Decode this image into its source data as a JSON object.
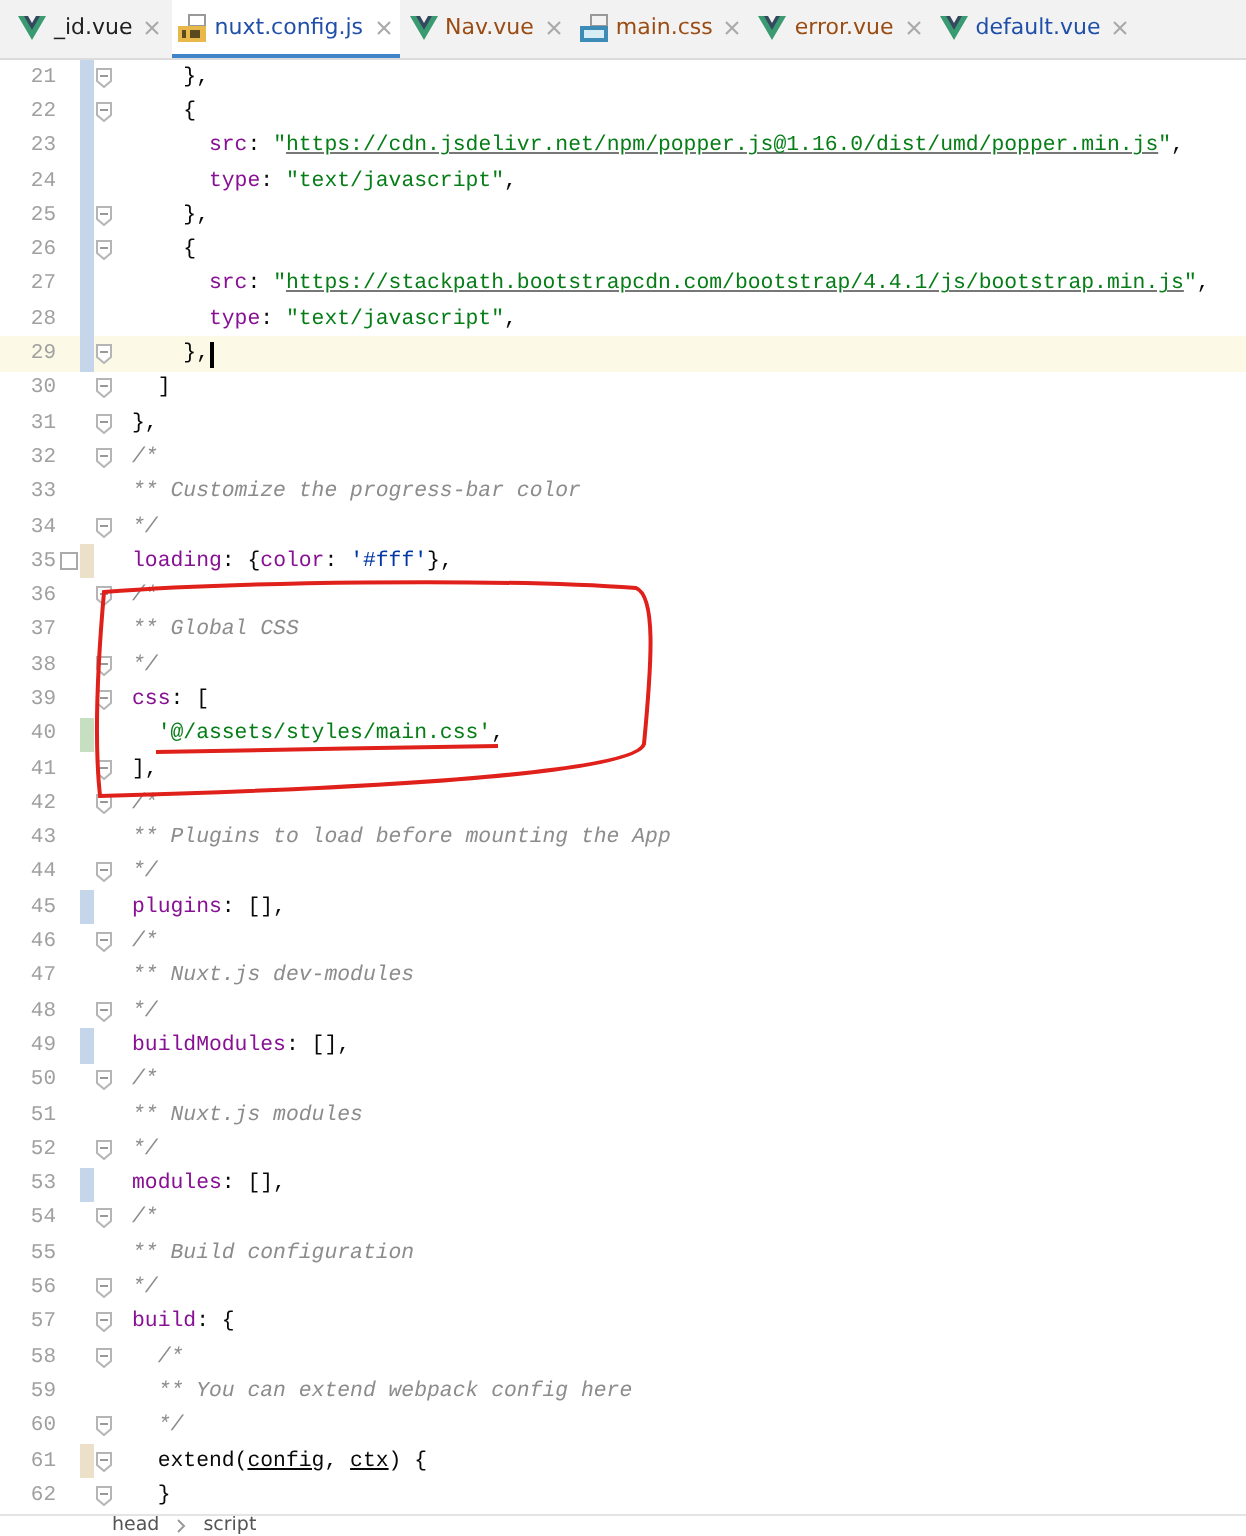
{
  "tabs": [
    {
      "label": "_id.vue",
      "kind": "vue",
      "color": "#202020",
      "selected": false
    },
    {
      "label": "nuxt.config.js",
      "kind": "js",
      "color": "#1f4fa8",
      "selected": true
    },
    {
      "label": "Nav.vue",
      "kind": "vue",
      "color": "#9a4c12",
      "selected": false
    },
    {
      "label": "main.css",
      "kind": "css",
      "color": "#9a4c12",
      "selected": false
    },
    {
      "label": "error.vue",
      "kind": "vue",
      "color": "#9a4c12",
      "selected": false
    },
    {
      "label": "default.vue",
      "kind": "vue",
      "color": "#1f4fa8",
      "selected": false
    }
  ],
  "lines": [
    {
      "number": "21",
      "color": "#c6d6ea",
      "fold": true,
      "bookmark": false,
      "current": false,
      "tokens": [
        {
          "kind": "plain",
          "text": "    },"
        }
      ]
    },
    {
      "number": "22",
      "color": "#c6d6ea",
      "fold": true,
      "bookmark": false,
      "current": false,
      "tokens": [
        {
          "kind": "plain",
          "text": "    {"
        }
      ]
    },
    {
      "number": "23",
      "color": "#c6d6ea",
      "fold": false,
      "bookmark": false,
      "current": false,
      "tokens": [
        {
          "kind": "key",
          "text": "      src"
        },
        {
          "kind": "plain",
          "text": ": "
        },
        {
          "kind": "string",
          "text": "\""
        },
        {
          "kind": "url",
          "text": "https://cdn.jsdelivr.net/npm/popper.js@1.16.0/dist/umd/popper.min.js"
        },
        {
          "kind": "string",
          "text": "\""
        },
        {
          "kind": "plain",
          "text": ","
        }
      ]
    },
    {
      "number": "24",
      "color": "#c6d6ea",
      "fold": false,
      "bookmark": false,
      "current": false,
      "tokens": [
        {
          "kind": "key",
          "text": "      type"
        },
        {
          "kind": "plain",
          "text": ": "
        },
        {
          "kind": "string",
          "text": "\"text/javascript\""
        },
        {
          "kind": "plain",
          "text": ","
        }
      ]
    },
    {
      "number": "25",
      "color": "#c6d6ea",
      "fold": true,
      "bookmark": false,
      "current": false,
      "tokens": [
        {
          "kind": "plain",
          "text": "    },"
        }
      ]
    },
    {
      "number": "26",
      "color": "#c6d6ea",
      "fold": true,
      "bookmark": false,
      "current": false,
      "tokens": [
        {
          "kind": "plain",
          "text": "    {"
        }
      ]
    },
    {
      "number": "27",
      "color": "#c6d6ea",
      "fold": false,
      "bookmark": false,
      "current": false,
      "tokens": [
        {
          "kind": "key",
          "text": "      src"
        },
        {
          "kind": "plain",
          "text": ": "
        },
        {
          "kind": "string",
          "text": "\""
        },
        {
          "kind": "url",
          "text": "https://stackpath.bootstrapcdn.com/bootstrap/4.4.1/js/bootstrap.min.js"
        },
        {
          "kind": "string",
          "text": "\""
        },
        {
          "kind": "plain",
          "text": ","
        }
      ]
    },
    {
      "number": "28",
      "color": "#c6d6ea",
      "fold": false,
      "bookmark": false,
      "current": false,
      "tokens": [
        {
          "kind": "key",
          "text": "      type"
        },
        {
          "kind": "plain",
          "text": ": "
        },
        {
          "kind": "string",
          "text": "\"text/javascript\""
        },
        {
          "kind": "plain",
          "text": ","
        }
      ]
    },
    {
      "number": "29",
      "color": "#c6d6ea",
      "fold": true,
      "bookmark": false,
      "current": true,
      "tokens": [
        {
          "kind": "plain",
          "text": "    },"
        }
      ]
    },
    {
      "number": "30",
      "fold": true,
      "bookmark": false,
      "current": false,
      "tokens": [
        {
          "kind": "plain",
          "text": "  ]"
        }
      ]
    },
    {
      "number": "31",
      "fold": true,
      "bookmark": false,
      "current": false,
      "tokens": [
        {
          "kind": "plain",
          "text": "},"
        }
      ]
    },
    {
      "number": "32",
      "fold": true,
      "bookmark": false,
      "current": false,
      "tokens": [
        {
          "kind": "comment",
          "text": "/*"
        }
      ]
    },
    {
      "number": "33",
      "fold": false,
      "bookmark": false,
      "current": false,
      "tokens": [
        {
          "kind": "comment",
          "text": "** Customize the progress-bar color"
        }
      ]
    },
    {
      "number": "34",
      "fold": true,
      "bookmark": false,
      "current": false,
      "tokens": [
        {
          "kind": "comment",
          "text": "*/"
        }
      ]
    },
    {
      "number": "35",
      "color": "#ece0c8",
      "fold": false,
      "bookmark": true,
      "current": false,
      "tokens": [
        {
          "kind": "key",
          "text": "loading"
        },
        {
          "kind": "plain",
          "text": ": {"
        },
        {
          "kind": "key",
          "text": "color"
        },
        {
          "kind": "plain",
          "text": ": "
        },
        {
          "kind": "hex",
          "text": "'#fff'"
        },
        {
          "kind": "plain",
          "text": "},"
        }
      ]
    },
    {
      "number": "36",
      "fold": true,
      "bookmark": false,
      "current": false,
      "tokens": [
        {
          "kind": "comment",
          "text": "/*"
        }
      ]
    },
    {
      "number": "37",
      "fold": false,
      "bookmark": false,
      "current": false,
      "tokens": [
        {
          "kind": "comment",
          "text": "** Global CSS"
        }
      ]
    },
    {
      "number": "38",
      "fold": true,
      "bookmark": false,
      "current": false,
      "tokens": [
        {
          "kind": "comment",
          "text": "*/"
        }
      ]
    },
    {
      "number": "39",
      "fold": true,
      "bookmark": false,
      "current": false,
      "tokens": [
        {
          "kind": "key",
          "text": "css"
        },
        {
          "kind": "plain",
          "text": ": ["
        }
      ]
    },
    {
      "number": "40",
      "color": "#c5dfc0",
      "fold": false,
      "bookmark": false,
      "current": false,
      "tokens": [
        {
          "kind": "string",
          "text": "  '@/assets/styles/main.css'"
        },
        {
          "kind": "plain",
          "text": ","
        }
      ]
    },
    {
      "number": "41",
      "fold": true,
      "bookmark": false,
      "current": false,
      "tokens": [
        {
          "kind": "plain",
          "text": "],"
        }
      ]
    },
    {
      "number": "42",
      "fold": true,
      "bookmark": false,
      "current": false,
      "tokens": [
        {
          "kind": "comment",
          "text": "/*"
        }
      ]
    },
    {
      "number": "43",
      "fold": false,
      "bookmark": false,
      "current": false,
      "tokens": [
        {
          "kind": "comment",
          "text": "** Plugins to load before mounting the App"
        }
      ]
    },
    {
      "number": "44",
      "fold": true,
      "bookmark": false,
      "current": false,
      "tokens": [
        {
          "kind": "comment",
          "text": "*/"
        }
      ]
    },
    {
      "number": "45",
      "color": "#c6d6ea",
      "fold": false,
      "bookmark": false,
      "current": false,
      "tokens": [
        {
          "kind": "key",
          "text": "plugins"
        },
        {
          "kind": "plain",
          "text": ": [],"
        }
      ]
    },
    {
      "number": "46",
      "fold": true,
      "bookmark": false,
      "current": false,
      "tokens": [
        {
          "kind": "comment",
          "text": "/*"
        }
      ]
    },
    {
      "number": "47",
      "fold": false,
      "bookmark": false,
      "current": false,
      "tokens": [
        {
          "kind": "comment",
          "text": "** Nuxt.js dev-modules"
        }
      ]
    },
    {
      "number": "48",
      "fold": true,
      "bookmark": false,
      "current": false,
      "tokens": [
        {
          "kind": "comment",
          "text": "*/"
        }
      ]
    },
    {
      "number": "49",
      "color": "#c6d6ea",
      "fold": false,
      "bookmark": false,
      "current": false,
      "tokens": [
        {
          "kind": "key",
          "text": "buildModules"
        },
        {
          "kind": "plain",
          "text": ": [],"
        }
      ]
    },
    {
      "number": "50",
      "fold": true,
      "bookmark": false,
      "current": false,
      "tokens": [
        {
          "kind": "comment",
          "text": "/*"
        }
      ]
    },
    {
      "number": "51",
      "fold": false,
      "bookmark": false,
      "current": false,
      "tokens": [
        {
          "kind": "comment",
          "text": "** Nuxt.js modules"
        }
      ]
    },
    {
      "number": "52",
      "fold": true,
      "bookmark": false,
      "current": false,
      "tokens": [
        {
          "kind": "comment",
          "text": "*/"
        }
      ]
    },
    {
      "number": "53",
      "color": "#c6d6ea",
      "fold": false,
      "bookmark": false,
      "current": false,
      "tokens": [
        {
          "kind": "key",
          "text": "modules"
        },
        {
          "kind": "plain",
          "text": ": [],"
        }
      ]
    },
    {
      "number": "54",
      "fold": true,
      "bookmark": false,
      "current": false,
      "tokens": [
        {
          "kind": "comment",
          "text": "/*"
        }
      ]
    },
    {
      "number": "55",
      "fold": false,
      "bookmark": false,
      "current": false,
      "tokens": [
        {
          "kind": "comment",
          "text": "** Build configuration"
        }
      ]
    },
    {
      "number": "56",
      "fold": true,
      "bookmark": false,
      "current": false,
      "tokens": [
        {
          "kind": "comment",
          "text": "*/"
        }
      ]
    },
    {
      "number": "57",
      "fold": true,
      "bookmark": false,
      "current": false,
      "tokens": [
        {
          "kind": "key",
          "text": "build"
        },
        {
          "kind": "plain",
          "text": ": {"
        }
      ]
    },
    {
      "number": "58",
      "fold": true,
      "bookmark": false,
      "current": false,
      "tokens": [
        {
          "kind": "comment",
          "text": "  /*"
        }
      ]
    },
    {
      "number": "59",
      "fold": false,
      "bookmark": false,
      "current": false,
      "tokens": [
        {
          "kind": "comment",
          "text": "  ** You can extend webpack config here"
        }
      ]
    },
    {
      "number": "60",
      "fold": true,
      "bookmark": false,
      "current": false,
      "tokens": [
        {
          "kind": "comment",
          "text": "  */"
        }
      ]
    },
    {
      "number": "61",
      "color": "#ece0c8",
      "fold": true,
      "bookmark": false,
      "current": false,
      "tokens": [
        {
          "kind": "plain",
          "text": "  extend("
        },
        {
          "kind": "param",
          "text": "config"
        },
        {
          "kind": "plain",
          "text": ", "
        },
        {
          "kind": "param",
          "text": "ctx"
        },
        {
          "kind": "plain",
          "text": ") {"
        }
      ]
    },
    {
      "number": "62",
      "fold": true,
      "bookmark": false,
      "current": false,
      "tokens": [
        {
          "kind": "plain",
          "text": "  }"
        }
      ]
    }
  ],
  "annotations": {
    "outline": true,
    "underline": true
  },
  "breadcrumb": [
    "head",
    "script"
  ]
}
